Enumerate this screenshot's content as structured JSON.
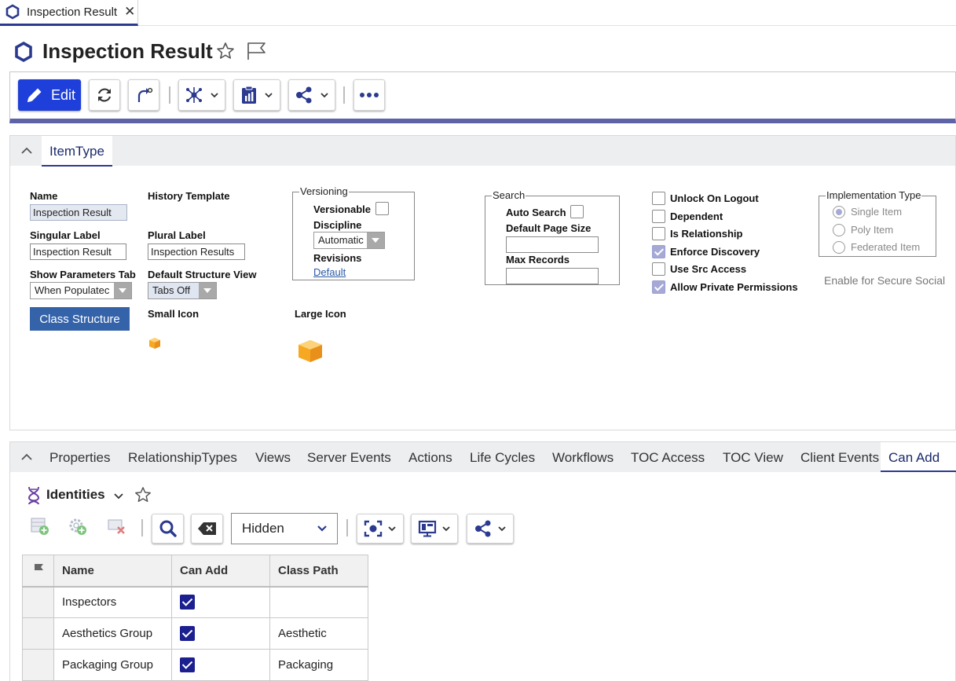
{
  "window_tab": {
    "label": "Inspection Result",
    "close_glyph": "✕"
  },
  "header": {
    "title": "Inspection Result"
  },
  "toolbar": {
    "edit_label": "Edit"
  },
  "itemtype_panel": {
    "tab_label": "ItemType",
    "fields": {
      "name_label": "Name",
      "name_value": "Inspection Result",
      "singular_label": "Singular Label",
      "singular_value": "Inspection Result",
      "show_params_label": "Show Parameters Tab",
      "show_params_value": "When Populatec",
      "history_template_label": "History Template",
      "plural_label": "Plural Label",
      "plural_value": "Inspection Results",
      "default_structure_label": "Default Structure View",
      "default_structure_value": "Tabs Off",
      "class_structure_button": "Class Structure",
      "small_icon_label": "Small Icon",
      "large_icon_label": "Large Icon"
    },
    "versioning": {
      "legend": "Versioning",
      "versionable_label": "Versionable",
      "versionable_checked": false,
      "discipline_label": "Discipline",
      "discipline_value": "Automatic",
      "revisions_label": "Revisions",
      "revisions_value": "Default"
    },
    "search": {
      "legend": "Search",
      "auto_search_label": "Auto Search",
      "auto_search_checked": false,
      "default_page_size_label": "Default Page Size",
      "default_page_size_value": "",
      "max_records_label": "Max Records",
      "max_records_value": ""
    },
    "options": [
      {
        "label": "Unlock On Logout",
        "checked": false
      },
      {
        "label": "Dependent",
        "checked": false
      },
      {
        "label": "Is Relationship",
        "checked": false
      },
      {
        "label": "Enforce Discovery",
        "checked": true
      },
      {
        "label": "Use Src Access",
        "checked": false
      },
      {
        "label": "Allow Private Permissions",
        "checked": true
      }
    ],
    "implementation_type": {
      "legend": "Implementation Type",
      "options": [
        {
          "label": "Single Item",
          "selected": true
        },
        {
          "label": "Poly Item",
          "selected": false
        },
        {
          "label": "Federated Item",
          "selected": false
        }
      ]
    },
    "secure_social_label": "Enable for Secure Social"
  },
  "relationship_tabs": [
    {
      "label": "Properties",
      "active": false
    },
    {
      "label": "RelationshipTypes",
      "active": false
    },
    {
      "label": "Views",
      "active": false
    },
    {
      "label": "Server Events",
      "active": false
    },
    {
      "label": "Actions",
      "active": false
    },
    {
      "label": "Life Cycles",
      "active": false
    },
    {
      "label": "Workflows",
      "active": false
    },
    {
      "label": "TOC Access",
      "active": false
    },
    {
      "label": "TOC View",
      "active": false
    },
    {
      "label": "Client Events",
      "active": false
    },
    {
      "label": "Can Add",
      "active": true
    }
  ],
  "relationship_view": {
    "title": "Identities",
    "view_select_value": "Hidden"
  },
  "grid": {
    "columns": [
      "Name",
      "Can Add",
      "Class Path"
    ],
    "rows": [
      {
        "name": "Inspectors",
        "can_add": true,
        "class_path": ""
      },
      {
        "name": "Aesthetics Group",
        "can_add": true,
        "class_path": "Aesthetic"
      },
      {
        "name": "Packaging Group",
        "can_add": true,
        "class_path": "Packaging"
      }
    ]
  },
  "colors": {
    "accent": "#2b3a8f",
    "edit_button": "#1e3fd9",
    "class_button": "#3563a9",
    "check": "#1b1f8f",
    "toolbar_bar": "#5e63a8"
  }
}
